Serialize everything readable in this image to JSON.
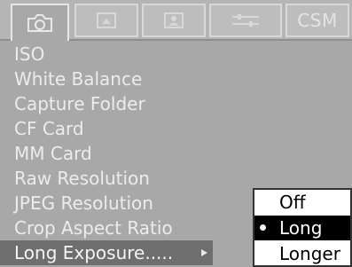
{
  "tabs": [
    {
      "id": "camera",
      "icon": "camera-icon"
    },
    {
      "id": "tab2",
      "icon": "frame-icon"
    },
    {
      "id": "tab3",
      "icon": "person-icon"
    },
    {
      "id": "tab4",
      "icon": "settings-icon"
    },
    {
      "id": "csm",
      "label": "CSM"
    }
  ],
  "menu": {
    "items": [
      {
        "label": "ISO"
      },
      {
        "label": "White Balance"
      },
      {
        "label": "Capture Folder"
      },
      {
        "label": "CF Card"
      },
      {
        "label": "MM Card"
      },
      {
        "label": "Raw Resolution"
      },
      {
        "label": "JPEG Resolution"
      },
      {
        "label": "Crop Aspect Ratio"
      },
      {
        "label": "Long Exposure......"
      }
    ],
    "selected_index": 8
  },
  "popup": {
    "options": [
      {
        "label": "Off"
      },
      {
        "label": "Long"
      },
      {
        "label": "Longer"
      }
    ],
    "selected_index": 1
  },
  "colors": {
    "background": "#a8a8a8",
    "text": "#ececec",
    "selected_row": "#6e6e6e"
  }
}
